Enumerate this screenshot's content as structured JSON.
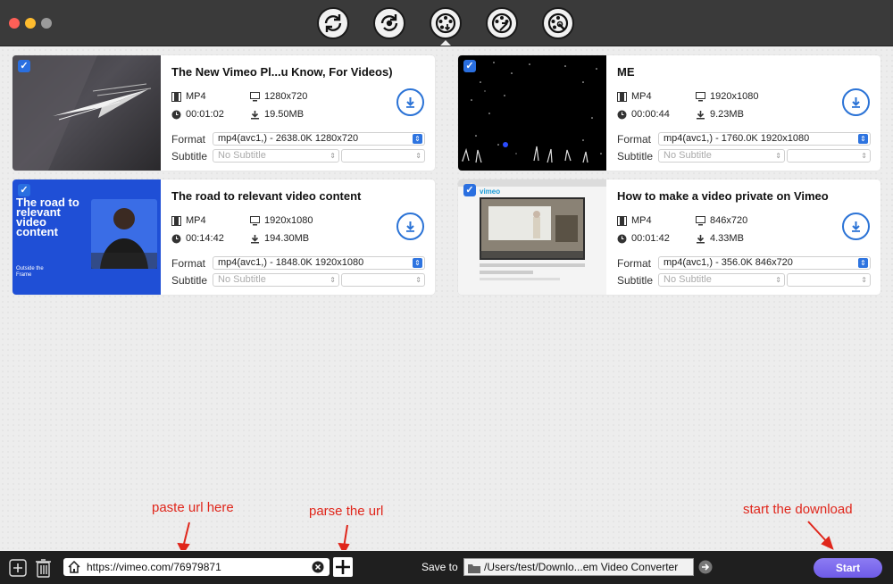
{
  "window": {
    "toolbar_icons": [
      "convert-icon",
      "convert-settings-icon",
      "download-video-icon",
      "edit-video-icon",
      "toolbox-icon"
    ],
    "active_tool": "download-video-icon"
  },
  "cards": [
    {
      "title": "The New Vimeo Pl...u Know, For Videos)",
      "container": "MP4",
      "resolution": "1280x720",
      "duration": "00:01:02",
      "size": "19.50MB",
      "format_label": "Format",
      "format_value": "mp4(avc1,) - 2638.0K 1280x720",
      "subtitle_label": "Subtitle",
      "subtitle_value": "No Subtitle",
      "checked": true
    },
    {
      "title": "ME",
      "container": "MP4",
      "resolution": "1920x1080",
      "duration": "00:00:44",
      "size": "9.23MB",
      "format_label": "Format",
      "format_value": "mp4(avc1,) - 1760.0K 1920x1080",
      "subtitle_label": "Subtitle",
      "subtitle_value": "No Subtitle",
      "checked": true
    },
    {
      "title": "The road to relevant video content",
      "container": "MP4",
      "resolution": "1920x1080",
      "duration": "00:14:42",
      "size": "194.30MB",
      "format_label": "Format",
      "format_value": "mp4(avc1,) - 1848.0K 1920x1080",
      "subtitle_label": "Subtitle",
      "subtitle_value": "No Subtitle",
      "checked": true,
      "thumb_text": "The road to relevant video content",
      "thumb_footer": "Outside the Frame"
    },
    {
      "title": "How to make a video private on Vimeo",
      "container": "MP4",
      "resolution": "846x720",
      "duration": "00:01:42",
      "size": "4.33MB",
      "format_label": "Format",
      "format_value": "mp4(avc1,) - 356.0K 846x720",
      "subtitle_label": "Subtitle",
      "subtitle_value": "No Subtitle",
      "checked": true,
      "thumb_text": "vimeo"
    }
  ],
  "annotations": {
    "paste": "paste url here",
    "parse": "parse the url",
    "start": "start the download"
  },
  "bottom": {
    "url_value": "https://vimeo.com/76979871",
    "save_to_label": "Save to",
    "save_path": "/Users/test/Downlo...em Video Converter",
    "start_label": "Start"
  },
  "colors": {
    "accent": "#2b73d6",
    "annotation": "#e0261b",
    "start_button": "#7a68ee"
  }
}
